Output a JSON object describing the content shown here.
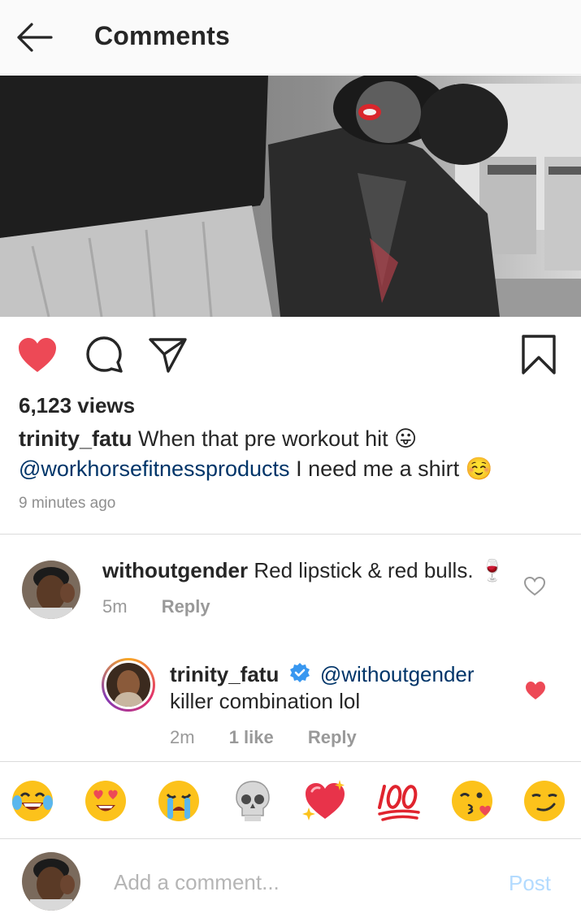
{
  "header": {
    "title": "Comments",
    "back_icon": "arrow-left-icon"
  },
  "post": {
    "liked": true,
    "views": "6,123 views",
    "caption_user": "trinity_fatu",
    "caption_line1": "When that pre workout hit 😛",
    "caption_mention": "@workhorsefitnessproducts",
    "caption_line2": "I need me a shirt ☺️",
    "time": "9 minutes ago"
  },
  "comments": [
    {
      "user": "withoutgender",
      "text": "Red lipstick & red bulls. 🍷",
      "time": "5m",
      "reply_label": "Reply",
      "liked": false
    },
    {
      "user": "trinity_fatu",
      "verified": true,
      "mention": "@withoutgender",
      "text": "killer combination lol",
      "time": "2m",
      "likes": "1 like",
      "reply_label": "Reply",
      "liked": true
    }
  ],
  "emoji_bar": [
    "😂",
    "😍",
    "😭",
    "💀",
    "💖",
    "💯",
    "😘",
    "😏"
  ],
  "composer": {
    "placeholder": "Add a comment...",
    "post_label": "Post"
  },
  "colors": {
    "like_red": "#ed4956",
    "mention_blue": "#003569",
    "verified_blue": "#3897f0",
    "post_disabled": "#b3dbff",
    "meta_gray": "#999999"
  }
}
